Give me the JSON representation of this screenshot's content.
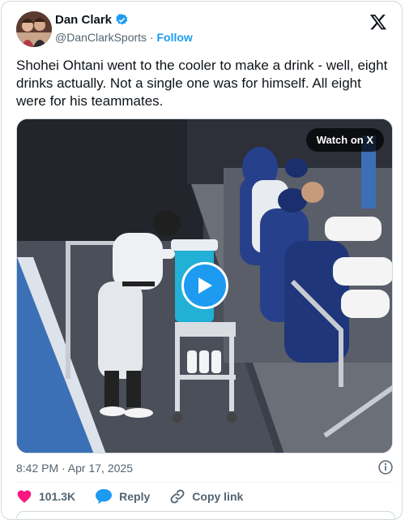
{
  "author": {
    "name": "Dan Clark",
    "handle": "@DanClarkSports",
    "separator": " · ",
    "follow_label": "Follow"
  },
  "post": {
    "text": "Shohei Ohtani went to the cooler to make a drink - well, eight drinks actually. Not a single one was for himself. All eight were for his teammates.",
    "timestamp": "8:42 PM · Apr 17, 2025"
  },
  "media": {
    "watch_label": "Watch on X"
  },
  "actions": {
    "likes": "101.3K",
    "reply_label": "Reply",
    "copy_label": "Copy link"
  },
  "colors": {
    "accent": "#1d9bf0",
    "like": "#f91880",
    "text": "#0f1419",
    "muted": "#536471"
  }
}
